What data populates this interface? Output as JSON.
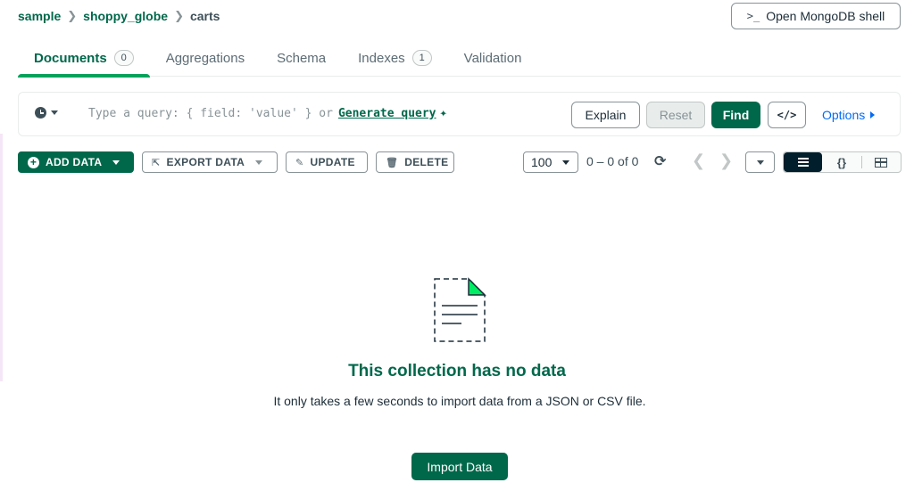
{
  "breadcrumb": {
    "items": [
      "sample",
      "shoppy_globe",
      "carts"
    ]
  },
  "shell_button": {
    "prompt": ">_",
    "label": "Open MongoDB shell"
  },
  "tabs": [
    {
      "label": "Documents",
      "count": "0",
      "active": true
    },
    {
      "label": "Aggregations"
    },
    {
      "label": "Schema"
    },
    {
      "label": "Indexes",
      "count": "1"
    },
    {
      "label": "Validation"
    }
  ],
  "query_bar": {
    "placeholder": "Type a query: { field: 'value' } or",
    "generate_label": "Generate query",
    "explain_label": "Explain",
    "reset_label": "Reset",
    "find_label": "Find",
    "code_label": "</>",
    "options_label": "Options"
  },
  "toolbar": {
    "add_data": "ADD DATA",
    "export_data": "EXPORT DATA",
    "update": "UPDATE",
    "delete": "DELETE",
    "page_size": "100",
    "range": "0 – 0 of 0"
  },
  "empty_state": {
    "title": "This collection has no data",
    "description": "It only takes a few seconds to import data from a JSON or CSV file.",
    "import_label": "Import Data"
  },
  "colors": {
    "brand_green": "#00684a",
    "accent_green": "#00a35c",
    "link_blue": "#016bf8",
    "dark": "#001e2b"
  }
}
